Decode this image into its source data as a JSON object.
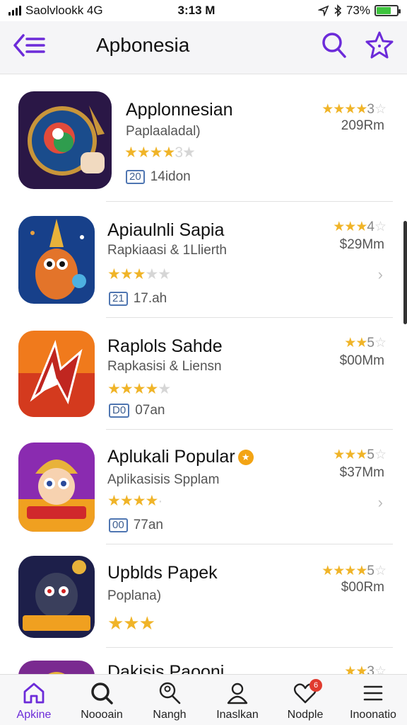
{
  "status_bar": {
    "carrier": "Saolvlookk 4G",
    "time": "3:13 M",
    "battery": "73%"
  },
  "header": {
    "title": "Apbonesia",
    "back_icon": "back-menu-icon",
    "search_icon": "search-icon",
    "star_icon": "star-icon",
    "accent": "#6c2bd9"
  },
  "apps": [
    {
      "name": "Applonnesian",
      "subtitle": "Paplaaladal)",
      "stars_text": "★★★★",
      "stars_dim": "3★",
      "meta_box": "20",
      "meta_text": "14idon",
      "rating_stars": "★★★★",
      "rating_num": "3",
      "rating_dim": "☆",
      "price": "209Rm",
      "chevron": ""
    },
    {
      "name": "Apiaulnli Sapia",
      "subtitle": "Rapkiaasi & 1Llierth",
      "stars_text": "★★★",
      "stars_dim": "★★",
      "meta_box": "21",
      "meta_text": "17.ah",
      "rating_stars": "★★★",
      "rating_num": "4",
      "rating_dim": "☆",
      "price": "$29Mm",
      "chevron": "›"
    },
    {
      "name": "Raplols Sahde",
      "subtitle": "Rapkasisi & Liensn",
      "stars_text": "★★★★",
      "stars_dim": "★",
      "meta_box": "D0",
      "meta_text": "07an",
      "rating_stars": "★★",
      "rating_num": "5",
      "rating_dim": "☆",
      "price": "$00Mm",
      "chevron": ""
    },
    {
      "name": "Aplukali Popular",
      "subtitle": "Aplikasisis Spplam",
      "stars_text": "★★★★",
      "stars_dim": "·",
      "meta_box": "00",
      "meta_text": "77an",
      "rating_stars": "★★★",
      "rating_num": "5",
      "rating_dim": "☆",
      "price": "$37Mm",
      "chevron": "›"
    },
    {
      "name": "Upblds Papek",
      "subtitle": "Poplana)",
      "stars_text": "★★★",
      "stars_dim": "",
      "meta_box": "",
      "meta_text": "",
      "rating_stars": "★★★★",
      "rating_num": "5",
      "rating_dim": "☆",
      "price": "$00Rm",
      "chevron": ""
    },
    {
      "name": "Dakisis Paooni",
      "subtitle": "",
      "stars_text": "",
      "stars_dim": "",
      "meta_box": "",
      "meta_text": "",
      "rating_stars": "★★",
      "rating_num": "3",
      "rating_dim": "☆",
      "price": "",
      "chevron": ""
    }
  ],
  "tabs": [
    {
      "label": "Apkine",
      "icon": "home-icon",
      "active": true
    },
    {
      "label": "Noooain",
      "icon": "search-icon",
      "active": false
    },
    {
      "label": "Nangh",
      "icon": "search-person-icon",
      "active": false
    },
    {
      "label": "Inaslkan",
      "icon": "person-icon",
      "active": false
    },
    {
      "label": "Nodple",
      "icon": "heart-icon",
      "badge": "6",
      "active": false
    },
    {
      "label": "Inoonatio",
      "icon": "menu-icon",
      "active": false
    }
  ],
  "colors": {
    "star": "#f0b428",
    "accent": "#6c2bd9",
    "badge_red": "#e03b2f",
    "badge_orange": "#f3a414"
  }
}
